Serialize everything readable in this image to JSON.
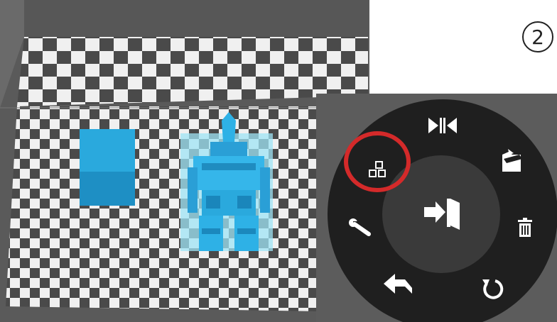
{
  "step_badge": {
    "label": "2"
  },
  "scene": {
    "objects": [
      {
        "name": "cube",
        "color": "#29a8dc",
        "selected": false
      },
      {
        "name": "robot-model",
        "color": "#2eb1e6",
        "selected": true,
        "selection_tint": "#9fe4f6"
      }
    ],
    "bed_colors": {
      "dark": "#4a4a4a",
      "light": "#f0f0f0"
    }
  },
  "radial_menu": {
    "background": "#1f1f1f",
    "center_action": "exit-edit-mode",
    "items": [
      {
        "action": "mirror",
        "icon": "mirror-icon"
      },
      {
        "action": "open-folder",
        "icon": "folder-open-icon"
      },
      {
        "action": "delete",
        "icon": "trash-icon"
      },
      {
        "action": "rotate",
        "icon": "rotate-icon"
      },
      {
        "action": "undo",
        "icon": "undo-arrow-icon"
      },
      {
        "action": "settings",
        "icon": "wrench-icon"
      },
      {
        "action": "arrange",
        "icon": "arrange-icon",
        "highlighted": true
      }
    ],
    "highlight_color": "#d42a2a"
  }
}
